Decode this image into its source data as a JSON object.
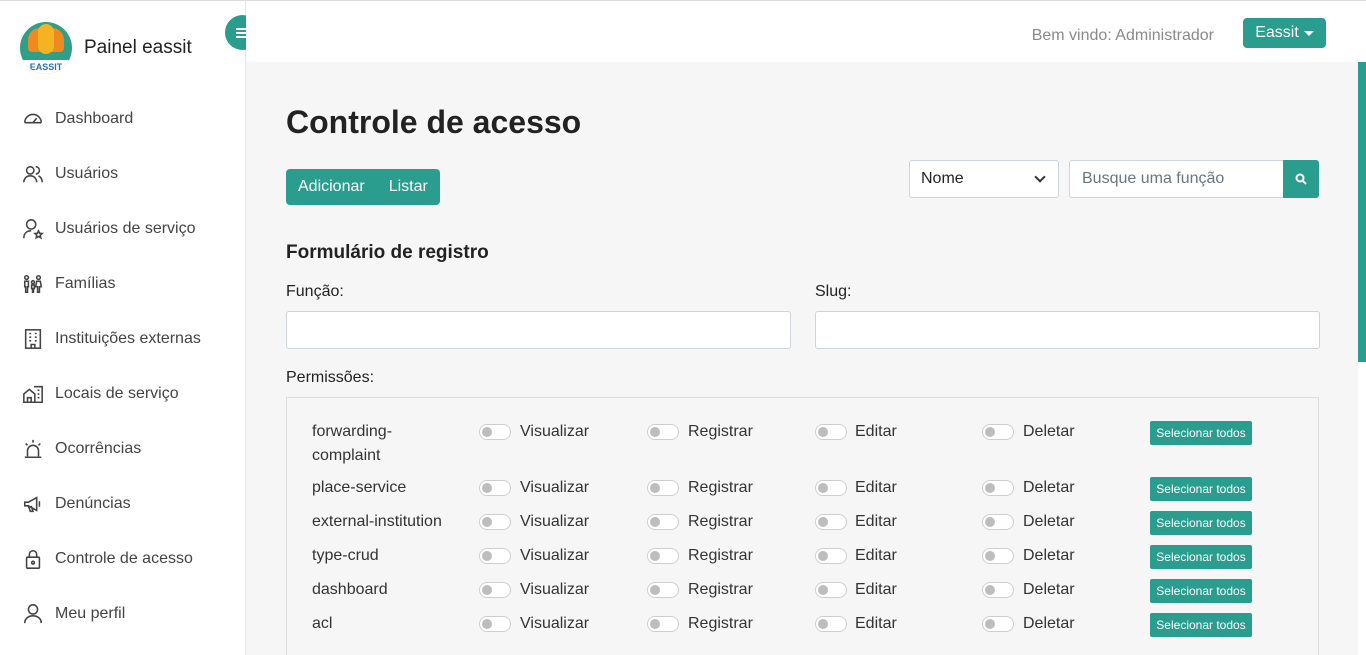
{
  "brand": {
    "logo_text": "EASSIT",
    "title": "Painel eassit"
  },
  "nav": [
    {
      "label": "Dashboard",
      "icon": "dashboard-icon"
    },
    {
      "label": "Usuários",
      "icon": "users-icon"
    },
    {
      "label": "Usuários de serviço",
      "icon": "service-user-icon"
    },
    {
      "label": "Famílias",
      "icon": "family-icon"
    },
    {
      "label": "Instituições externas",
      "icon": "building-icon"
    },
    {
      "label": "Locais de serviço",
      "icon": "house-building-icon"
    },
    {
      "label": "Ocorrências",
      "icon": "alarm-icon"
    },
    {
      "label": "Denúncias",
      "icon": "megaphone-icon"
    },
    {
      "label": "Controle de acesso",
      "icon": "lock-icon"
    },
    {
      "label": "Meu perfil",
      "icon": "user-icon"
    }
  ],
  "header": {
    "welcome": "Bem vindo: Administrador",
    "user_menu": "Eassit"
  },
  "page": {
    "title": "Controle de acesso",
    "add_button": "Adicionar",
    "list_button": "Listar",
    "filter_select": "Nome",
    "search_placeholder": "Busque uma função"
  },
  "form": {
    "title": "Formulário de registro",
    "function_label": "Função:",
    "slug_label": "Slug:",
    "permissions_label": "Permissões:",
    "function_value": "",
    "slug_value": ""
  },
  "permission_actions": [
    "Visualizar",
    "Registrar",
    "Editar",
    "Deletar"
  ],
  "select_all_label": "Selecionar todos",
  "permissions": [
    {
      "name": "forwarding-complaint"
    },
    {
      "name": "place-service"
    },
    {
      "name": "external-institution"
    },
    {
      "name": "type-crud"
    },
    {
      "name": "dashboard"
    },
    {
      "name": "acl"
    }
  ],
  "colors": {
    "accent": "#2a9d8f",
    "background": "#f6f6f6"
  }
}
